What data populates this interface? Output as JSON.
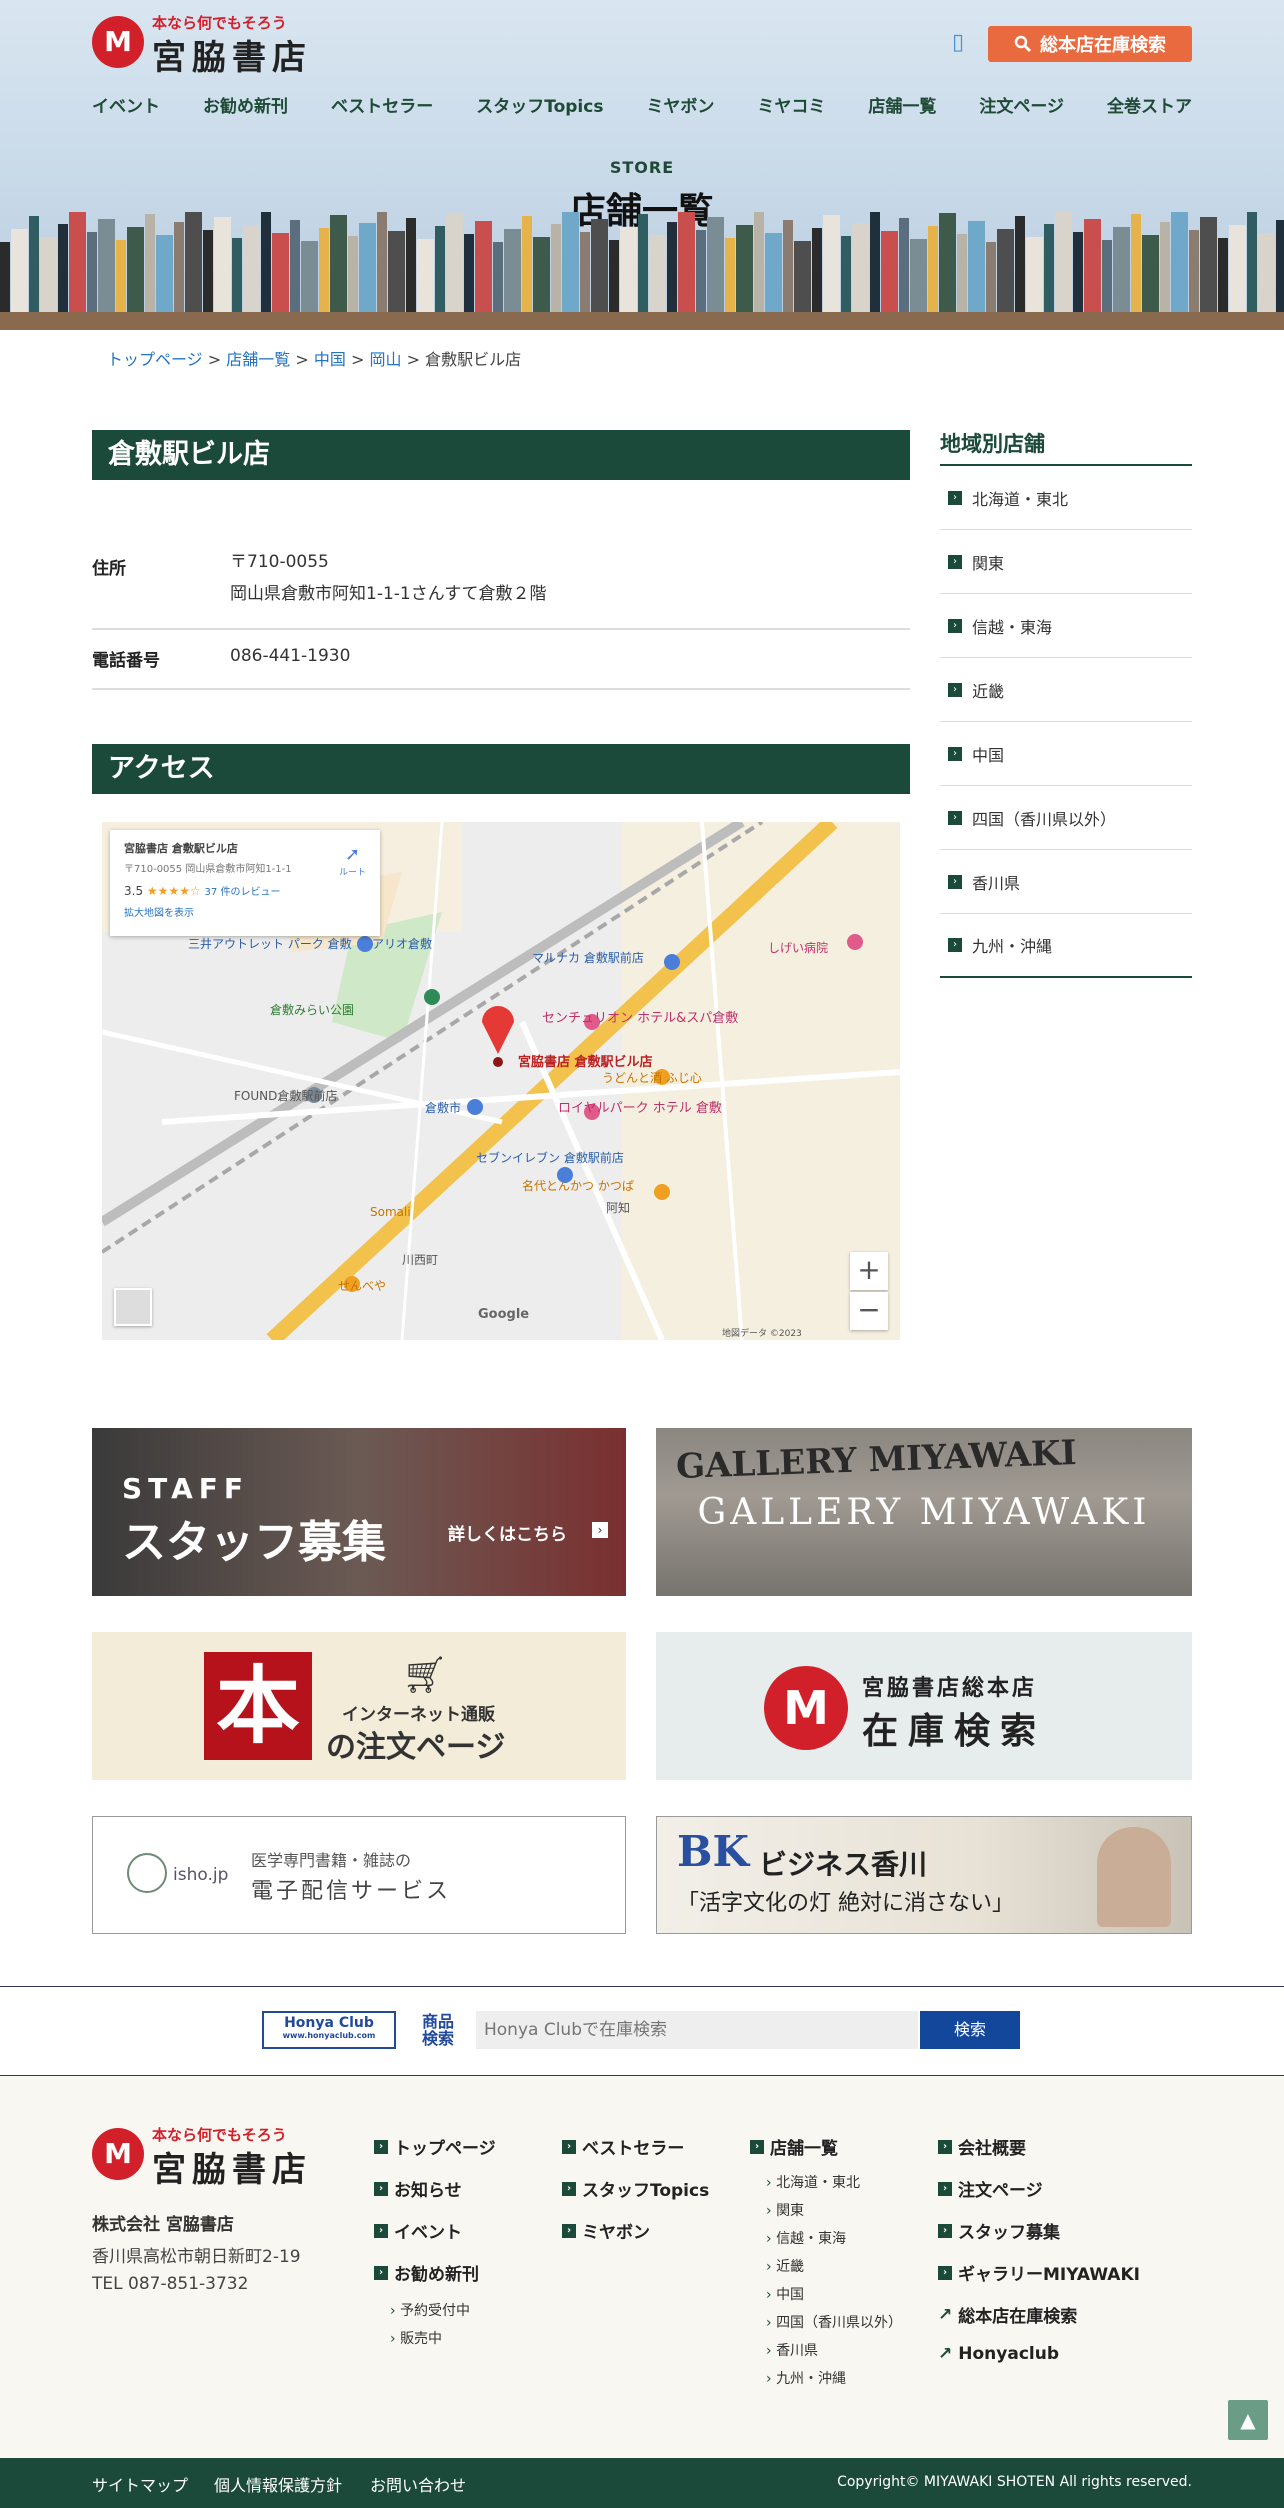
{
  "header": {
    "logo_tagline": "本なら何でもそろう",
    "logo_name": "宮脇書店",
    "logo_mark": "M",
    "stock_search_label": "総本店在庫検索",
    "nav": [
      "イベント",
      "お勧め新刊",
      "ベストセラー",
      "スタッフTopics",
      "ミヤボン",
      "ミヤコミ",
      "店舗一覧",
      "注文ページ",
      "全巻ストア"
    ]
  },
  "hero": {
    "label": "STORE",
    "title": "店舗一覧"
  },
  "breadcrumb": {
    "items": [
      "トップページ",
      "店舗一覧",
      "中国",
      "岡山"
    ],
    "current": "倉敷駅ビル店",
    "sep": ">"
  },
  "store": {
    "name": "倉敷駅ビル店",
    "address_label": "住所",
    "postal": "〒710-0055",
    "address": "岡山県倉敷市阿知1-1-1さんすて倉敷２階",
    "phone_label": "電話番号",
    "phone": "086-441-1930"
  },
  "access": {
    "title": "アクセス",
    "map_card": {
      "name": "宮脇書店 倉敷駅ビル店",
      "address": "〒710-0055 岡山県倉敷市阿知1-1-1",
      "rating": "3.5",
      "stars": "★★★★☆",
      "reviews": "37 件のレビュー",
      "larger": "拡大地図を表示",
      "route": "ルート"
    },
    "map_labels": {
      "store": "宮脇書店 倉敷駅ビル店",
      "centurion": "センチュリオン ホテル&スパ倉敷",
      "royal": "ロイヤルパーク ホテル 倉敷",
      "seven": "セブンイレブン 倉敷駅前店",
      "marunaka": "マルナカ 倉敷駅前店",
      "ario": "アリオ倉敷",
      "mitsui": "三井アウトレット パーク 倉敷",
      "park": "倉敷みらい公園",
      "found": "FOUND倉敷駅前店",
      "station": "倉敷市",
      "udon": "うどんと酒 ふじ心",
      "katsu": "名代とんかつ かつぱ",
      "somali": "Somali",
      "senbeya": "せんべや",
      "achi": "阿知",
      "kawanishi": "川西町",
      "hospital": "しげい病院",
      "google": "Google",
      "copyright": "地図データ ©2023"
    },
    "zoom_in": "+",
    "zoom_out": "−"
  },
  "sidebar": {
    "title": "地域別店舗",
    "items": [
      "北海道・東北",
      "関東",
      "信越・東海",
      "近畿",
      "中国",
      "四国（香川県以外）",
      "香川県",
      "九州・沖縄"
    ]
  },
  "banners": {
    "staff_small": "STAFF",
    "staff_big": "スタッフ募集",
    "staff_more": "詳しくはこちら",
    "gallery": "GALLERY MIYAWAKI",
    "gallery_wall": "GALLERY MIYAWAKI",
    "order_kanji": "本",
    "order_small": "インターネット通販",
    "order_big": "の注文ページ",
    "stock_top": "宮脇書店総本店",
    "stock_big": "在庫検索",
    "isho_logo": "isho.jp",
    "isho_top": "医学専門書籍・雑誌の",
    "isho_big": "電子配信サービス",
    "bk_logo": "BK",
    "bk_top": "ビジネス香川",
    "bk_quote": "「活字文化の灯 絶対に消さない」"
  },
  "honya": {
    "logo": "Honya Club",
    "logo_url": "www.honyaclub.com",
    "label": "商品検索",
    "placeholder": "Honya Clubで在庫検索",
    "button": "検索"
  },
  "footer": {
    "company": "株式会社 宮脇書店",
    "address": "香川県高松市朝日新町2-19",
    "tel": "TEL 087-851-3732",
    "col1": [
      "トップページ",
      "お知らせ",
      "イベント",
      "お勧め新刊"
    ],
    "col1_sub": [
      "予約受付中",
      "販売中"
    ],
    "col2": [
      "ベストセラー",
      "スタッフTopics",
      "ミヤボン"
    ],
    "col3_title": "店舗一覧",
    "col3_sub": [
      "北海道・東北",
      "関東",
      "信越・東海",
      "近畿",
      "中国",
      "四国（香川県以外）",
      "香川県",
      "九州・沖縄"
    ],
    "col4": [
      "会社概要",
      "注文ページ",
      "スタッフ募集",
      "ギャラリーMIYAWAKI",
      "総本店在庫検索",
      "Honyaclub"
    ]
  },
  "bottom": {
    "links": [
      "サイトマップ",
      "個人情報保護方針",
      "お問い合わせ"
    ],
    "copyright": "Copyright© MIYAWAKI SHOTEN All rights reserved."
  },
  "colors": {
    "brand_green": "#1b4a3a",
    "brand_red": "#d2202b",
    "accent_orange": "#e96a3f",
    "link_blue": "#2474c1"
  }
}
